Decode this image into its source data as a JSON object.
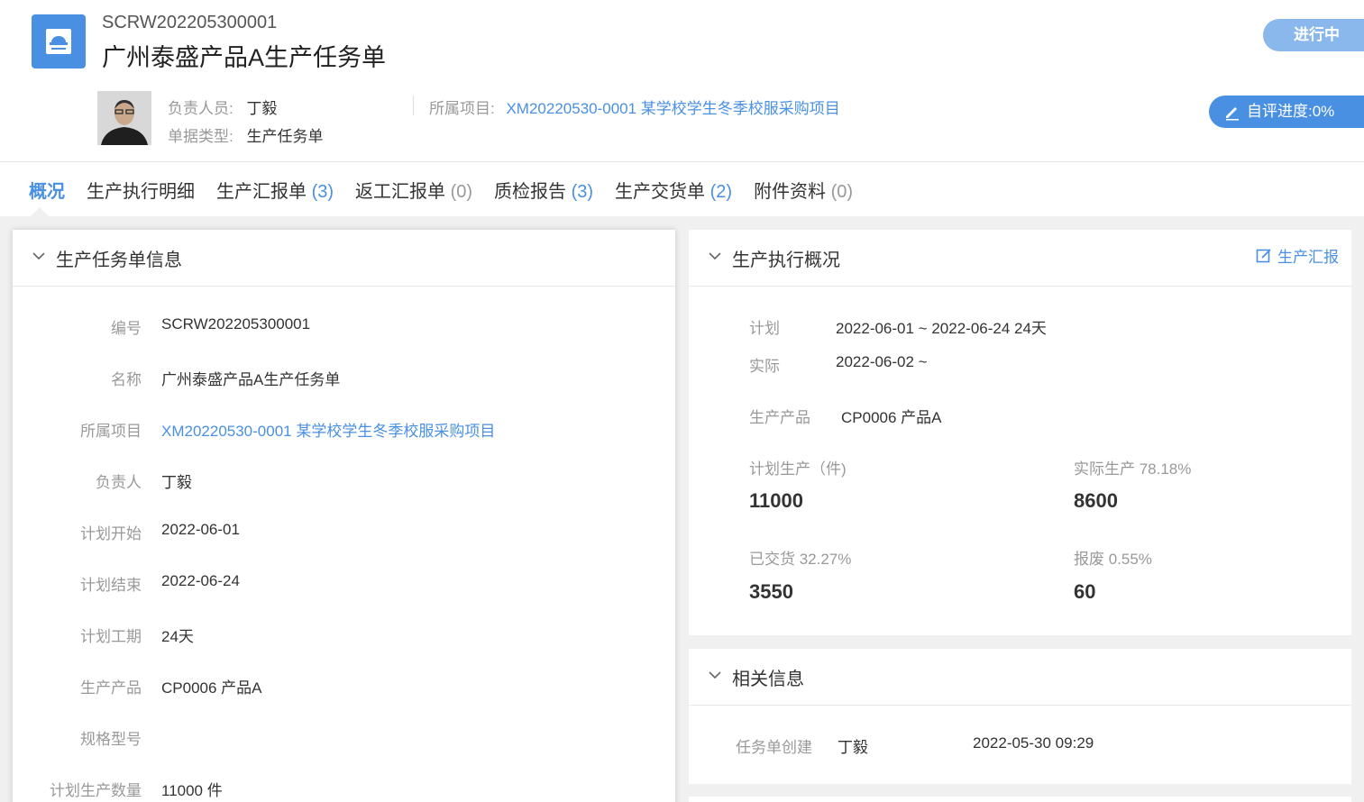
{
  "header": {
    "code": "SCRW202205300001",
    "title": "广州泰盛产品A生产任务单",
    "status": "进行中",
    "progress_button": "自评进度:0%",
    "owner_label": "负责人员:",
    "owner": "丁毅",
    "doc_type_label": "单据类型:",
    "doc_type": "生产任务单",
    "project_label": "所属项目:",
    "project": "XM20220530-0001 某学校学生冬季校服采购项目"
  },
  "tabs": [
    {
      "label": "概况",
      "count": ""
    },
    {
      "label": "生产执行明细",
      "count": ""
    },
    {
      "label": "生产汇报单",
      "count": "(3)"
    },
    {
      "label": "返工汇报单",
      "count": "(0)"
    },
    {
      "label": "质检报告",
      "count": "(3)"
    },
    {
      "label": "生产交货单",
      "count": "(2)"
    },
    {
      "label": "附件资料",
      "count": "(0)"
    }
  ],
  "info": {
    "title": "生产任务单信息",
    "fields": [
      {
        "label": "编号",
        "value": "SCRW202205300001"
      },
      {
        "label": "名称",
        "value": "广州泰盛产品A生产任务单"
      },
      {
        "label": "所属项目",
        "value": "XM20220530-0001 某学校学生冬季校服采购项目"
      },
      {
        "label": "负责人",
        "value": "丁毅"
      },
      {
        "label": "计划开始",
        "value": "2022-06-01"
      },
      {
        "label": "计划结束",
        "value": "2022-06-24"
      },
      {
        "label": "计划工期",
        "value": "24天"
      },
      {
        "label": "生产产品",
        "value": "CP0006 产品A"
      },
      {
        "label": "规格型号",
        "value": ""
      },
      {
        "label": "计划生产数量",
        "value": "11000 件"
      }
    ]
  },
  "exec": {
    "title": "生产执行概况",
    "action": "生产汇报",
    "plan_label": "计划",
    "plan_value": "2022-06-01 ~ 2022-06-24 24天",
    "actual_label": "实际",
    "actual_value": "2022-06-02 ~",
    "product_label": "生产产品",
    "product_value": "CP0006 产品A",
    "planned_label": "计划生产（件)",
    "planned_value": "11000",
    "actual_prod_label": "实际生产 78.18%",
    "actual_prod_value": "8600",
    "delivered_label": "已交货 32.27%",
    "delivered_value": "3550",
    "scrap_label": "报废 0.55%",
    "scrap_value": "60"
  },
  "related": {
    "title": "相关信息",
    "event": "任务单创建",
    "person": "丁毅",
    "time": "2022-05-30 09:29"
  }
}
